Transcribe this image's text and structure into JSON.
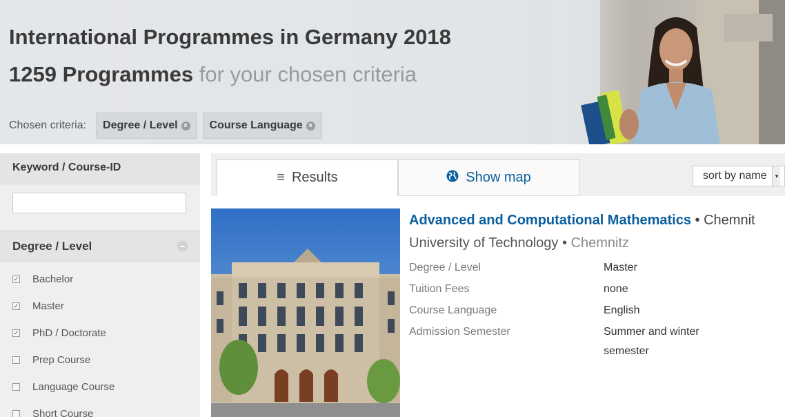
{
  "banner": {
    "title": "International Programmes in Germany 2018",
    "count": "1259 Programmes",
    "subtitle_rest": "for your chosen criteria",
    "criteria_label": "Chosen criteria:",
    "chips": [
      {
        "label": "Degree / Level"
      },
      {
        "label": "Course Language"
      }
    ]
  },
  "sidebar": {
    "keyword_heading": "Keyword / Course-ID",
    "keyword_value": "",
    "degree_heading": "Degree / Level",
    "options": [
      {
        "label": "Bachelor",
        "checked": true
      },
      {
        "label": "Master",
        "checked": true
      },
      {
        "label": "PhD / Doctorate",
        "checked": true
      },
      {
        "label": "Prep Course",
        "checked": false
      },
      {
        "label": "Language Course",
        "checked": false
      },
      {
        "label": "Short Course",
        "checked": false
      }
    ]
  },
  "tabs": {
    "results": "Results",
    "map": "Show map",
    "sort": "sort by name"
  },
  "result": {
    "name": "Advanced and Computational Mathematics",
    "sep": " • ",
    "city_trunc": "Chemnit",
    "university": "University of Technology",
    "city": "Chemnitz",
    "fields": [
      {
        "key": "Degree / Level",
        "value": "Master"
      },
      {
        "key": "Tuition Fees",
        "value": "none"
      },
      {
        "key": "Course Language",
        "value": "English"
      },
      {
        "key": "Admission Semester",
        "value": "Summer and winter semester"
      }
    ]
  },
  "colors": {
    "link": "#0a5f9e",
    "banner_bg": "#e4e7ea",
    "sidebar_bg": "#eeeff0"
  }
}
